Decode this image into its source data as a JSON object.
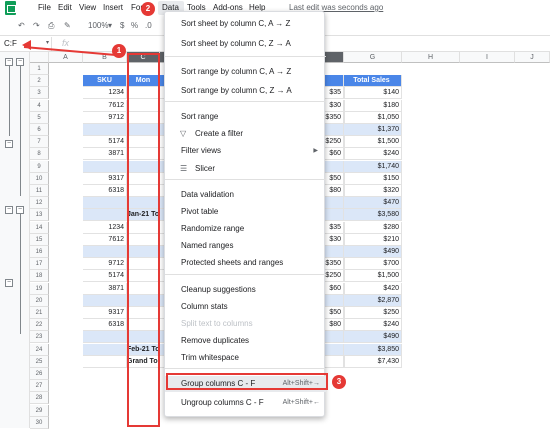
{
  "menubar": {
    "items": [
      "File",
      "Edit",
      "View",
      "Insert",
      "Format",
      "Data",
      "Tools",
      "Add-ons",
      "Help"
    ],
    "last_edit": "Last edit was seconds ago"
  },
  "toolbar": {
    "zoom": "100%"
  },
  "formula_bar": {
    "name_box": "C:F",
    "fx": "fx"
  },
  "columns": [
    "A",
    "B",
    "C",
    "D",
    "E",
    "F",
    "G",
    "H",
    "I",
    "J"
  ],
  "sheet": {
    "headers": {
      "sku": "SKU",
      "month": "Mon",
      "total_sales": "Total Sales"
    },
    "rows": [
      {
        "n": "1",
        "sku": "",
        "b": "",
        "f": "",
        "g": ""
      },
      {
        "n": "2",
        "sku": "SKU",
        "b": "Mon",
        "f": "",
        "g": "Total Sales"
      },
      {
        "n": "3",
        "sku": "1234",
        "b": "",
        "f": "$35",
        "g": "$140"
      },
      {
        "n": "4",
        "sku": "7612",
        "b": "",
        "f": "$30",
        "g": "$180"
      },
      {
        "n": "5",
        "sku": "9712",
        "b": "",
        "f": "$350",
        "g": "$1,050"
      },
      {
        "n": "6",
        "sku": "",
        "b": "",
        "f": "",
        "g": "$1,370"
      },
      {
        "n": "7",
        "sku": "5174",
        "b": "",
        "f": "$250",
        "g": "$1,500"
      },
      {
        "n": "8",
        "sku": "3871",
        "b": "",
        "f": "$60",
        "g": "$240"
      },
      {
        "n": "9",
        "sku": "",
        "b": "",
        "f": "",
        "g": "$1,740"
      },
      {
        "n": "10",
        "sku": "9317",
        "b": "",
        "f": "$50",
        "g": "$150"
      },
      {
        "n": "11",
        "sku": "6318",
        "b": "",
        "f": "$80",
        "g": "$320"
      },
      {
        "n": "12",
        "sku": "",
        "b": "",
        "f": "",
        "g": "$470"
      },
      {
        "n": "13",
        "sku": "",
        "b": "Jan-21 To",
        "f": "",
        "g": "$3,580"
      },
      {
        "n": "14",
        "sku": "1234",
        "b": "",
        "f": "$35",
        "g": "$280"
      },
      {
        "n": "15",
        "sku": "7612",
        "b": "",
        "f": "$30",
        "g": "$210"
      },
      {
        "n": "16",
        "sku": "",
        "b": "",
        "f": "",
        "g": "$490"
      },
      {
        "n": "17",
        "sku": "9712",
        "b": "",
        "f": "$350",
        "g": "$700"
      },
      {
        "n": "18",
        "sku": "5174",
        "b": "",
        "f": "$250",
        "g": "$1,500"
      },
      {
        "n": "19",
        "sku": "3871",
        "b": "",
        "f": "$60",
        "g": "$420"
      },
      {
        "n": "20",
        "sku": "",
        "b": "",
        "f": "",
        "g": "$2,870"
      },
      {
        "n": "21",
        "sku": "9317",
        "b": "",
        "f": "$50",
        "g": "$250"
      },
      {
        "n": "22",
        "sku": "6318",
        "b": "",
        "f": "$80",
        "g": "$240"
      },
      {
        "n": "23",
        "sku": "",
        "b": "",
        "f": "",
        "g": "$490"
      },
      {
        "n": "24",
        "sku": "",
        "b": "Feb-21 To",
        "f": "",
        "g": "$3,850"
      },
      {
        "n": "25",
        "sku": "",
        "b": "Grand To",
        "f": "",
        "g": "$7,430"
      },
      {
        "n": "26",
        "sku": "",
        "b": "",
        "f": "",
        "g": ""
      },
      {
        "n": "27",
        "sku": "",
        "b": "",
        "f": "",
        "g": ""
      },
      {
        "n": "28",
        "sku": "",
        "b": "",
        "f": "",
        "g": ""
      },
      {
        "n": "29",
        "sku": "",
        "b": "",
        "f": "",
        "g": ""
      },
      {
        "n": "30",
        "sku": "",
        "b": "",
        "f": "",
        "g": ""
      }
    ]
  },
  "data_menu": {
    "items": [
      {
        "label": "Sort sheet by column C, A → Z"
      },
      {
        "label": "Sort sheet by column C, Z → A"
      },
      {
        "label": "Sort range by column C, A → Z"
      },
      {
        "label": "Sort range by column C, Z → A"
      },
      {
        "label": "Sort range"
      },
      {
        "label": "Create a filter"
      },
      {
        "label": "Filter views"
      },
      {
        "label": "Slicer"
      },
      {
        "label": "Data validation"
      },
      {
        "label": "Pivot table"
      },
      {
        "label": "Randomize range"
      },
      {
        "label": "Named ranges"
      },
      {
        "label": "Protected sheets and ranges"
      },
      {
        "label": "Cleanup suggestions"
      },
      {
        "label": "Column stats"
      },
      {
        "label": "Split text to columns"
      },
      {
        "label": "Remove duplicates"
      },
      {
        "label": "Trim whitespace"
      },
      {
        "label": "Group columns C - F",
        "shortcut": "Alt+Shift+→"
      },
      {
        "label": "Ungroup columns C - F",
        "shortcut": "Alt+Shift+←"
      }
    ]
  },
  "annotations": {
    "badge1": "1",
    "badge2": "2",
    "badge3": "3",
    "accent": "#e53935"
  }
}
